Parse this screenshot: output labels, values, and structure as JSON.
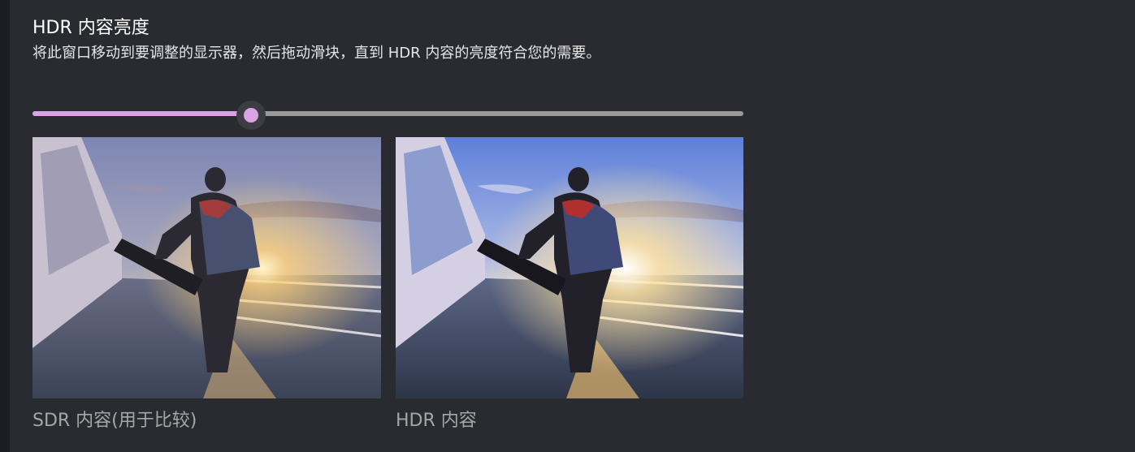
{
  "header": {
    "title": "HDR 内容亮度",
    "description": "将此窗口移动到要调整的显示器，然后拖动滑块，直到 HDR 内容的亮度符合您的需要。"
  },
  "slider": {
    "value_fraction": 0.307,
    "accent_color": "#d9a3e6",
    "track_color": "#9a9a9a"
  },
  "previews": [
    {
      "caption": "SDR 内容(用于比较)"
    },
    {
      "caption": "HDR 内容"
    }
  ]
}
